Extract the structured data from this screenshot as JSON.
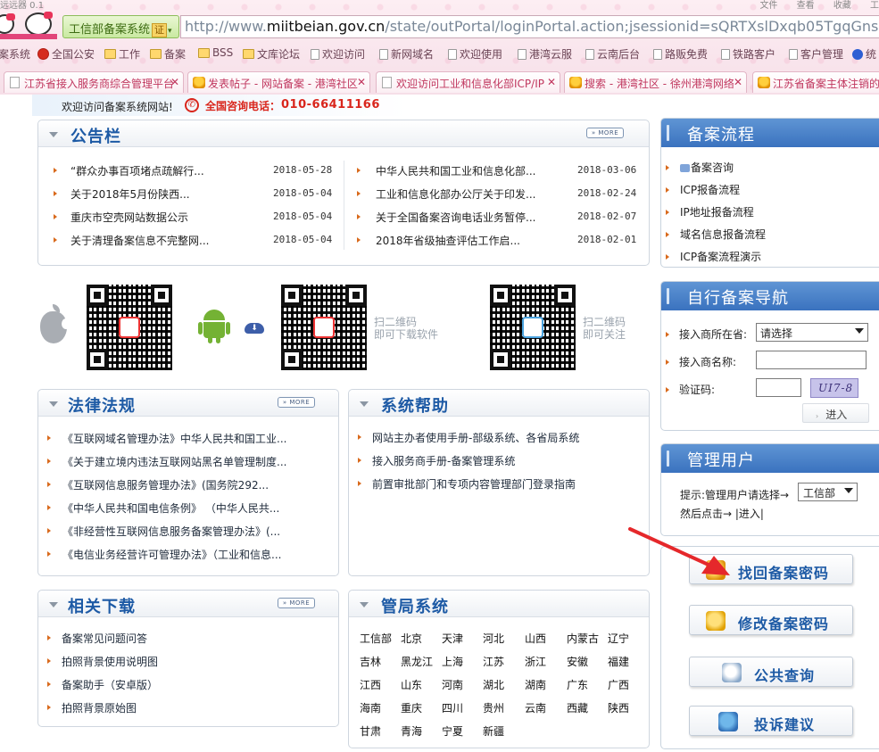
{
  "browser": {
    "top_left_text": "远远器 0.1",
    "top_right": [
      "文件",
      "查看",
      "收藏",
      "工"
    ],
    "site_badge": "工信部备案系统",
    "cert_label": "证",
    "url_prefix": "http://www.",
    "url_domain": "miitbeian.gov.cn",
    "url_rest": "/state/outPortal/loginPortal.action;jsessionid=sQRTXslDxqb05TgqGnsgrh2Fpv7",
    "bookmarks": [
      "案系统",
      "全国公安",
      "工作",
      "备案",
      "BSS",
      "文库论坛",
      "欢迎访问",
      "新网域名",
      "欢迎使用",
      "港湾云服",
      "云南后台",
      "路贩免费",
      "铁路客户",
      "客户管理",
      "统"
    ],
    "tabs": [
      "江苏省接入服务商综合管理平台",
      "发表帖子 - 网站备案 - 港湾社区",
      "欢迎访问工业和信息化部ICP/IP",
      "搜索 - 港湾社区 - 徐州港湾网络",
      "江苏省备案主体注销的"
    ]
  },
  "banner": {
    "welcome": "欢迎访问备案系统网站!",
    "hotline_label": "全国咨询电话：",
    "hotline_number": "010-66411166"
  },
  "bulletin": {
    "title": "公告栏",
    "more": "» MORE",
    "left": [
      {
        "text": "“群众办事百项堵点疏解行...",
        "date": "2018-05-28"
      },
      {
        "text": "关于2018年5月份陕西...",
        "date": "2018-05-04"
      },
      {
        "text": "重庆市空壳网站数据公示",
        "date": "2018-05-04"
      },
      {
        "text": "关于清理备案信息不完整网...",
        "date": "2018-05-04"
      }
    ],
    "right": [
      {
        "text": "中华人民共和国工业和信息化部...",
        "date": "2018-03-06"
      },
      {
        "text": "工业和信息化部办公厅关于印发...",
        "date": "2018-02-24"
      },
      {
        "text": "关于全国备案咨询电话业务暂停...",
        "date": "2018-02-07"
      },
      {
        "text": "2018年省级抽查评估工作启...",
        "date": "2018-02-01"
      }
    ]
  },
  "qr": {
    "download_hint_1": "扫二维码",
    "download_hint_2": "即可下载软件",
    "follow_hint_1": "扫二维码",
    "follow_hint_2": "即可关注"
  },
  "laws": {
    "title": "法律法规",
    "more": "» MORE",
    "items": [
      "《互联网域名管理办法》中华人民共和国工业...",
      "《关于建立境内违法互联网站黑名单管理制度...",
      "《互联网信息服务管理办法》(国务院292...",
      "《中华人民共和国电信条例》 （中华人民共...",
      "《非经营性互联网信息服务备案管理办法》(...",
      "《电信业务经营许可管理办法》（工业和信息..."
    ]
  },
  "help": {
    "title": "系统帮助",
    "items": [
      "网站主办者使用手册-部级系统、各省局系统",
      "接入服务商手册-备案管理系统",
      "前置审批部门和专项内容管理部门登录指南"
    ]
  },
  "downloads": {
    "title": "相关下载",
    "more": "» MORE",
    "items": [
      "备案常见问题问答",
      "拍照背景使用说明图",
      "备案助手（安卓版）",
      "拍照背景原始图"
    ]
  },
  "bureau": {
    "title": "管局系统",
    "rows": [
      [
        "工信部",
        "北京",
        "天津",
        "河北",
        "山西",
        "内蒙古",
        "辽宁"
      ],
      [
        "吉林",
        "黑龙江",
        "上海",
        "江苏",
        "浙江",
        "安徽",
        "福建"
      ],
      [
        "江西",
        "山东",
        "河南",
        "湖北",
        "湖南",
        "广东",
        "广西"
      ],
      [
        "海南",
        "重庆",
        "四川",
        "贵州",
        "云南",
        "西藏",
        "陕西"
      ],
      [
        "甘肃",
        "青海",
        "宁夏",
        "新疆"
      ]
    ]
  },
  "process": {
    "title": "备案流程",
    "items": [
      "备案咨询",
      "ICP报备流程",
      "IP地址报备流程",
      "域名信息报备流程",
      "ICP备案流程演示"
    ]
  },
  "self_nav": {
    "title": "自行备案导航",
    "province_label": "接入商所在省:",
    "province_value": "请选择",
    "name_label": "接入商名称:",
    "name_value": "",
    "captcha_label": "验证码:",
    "captcha_value": "",
    "captcha_text": "UI7-8",
    "enter_label": "进入"
  },
  "admin": {
    "title": "管理用户",
    "hint": "提示:管理用户请选择→",
    "select_value": "工信部",
    "then": "然后点击→",
    "enter_link": "|进入|"
  },
  "actions": {
    "retrieve_password": "找回备案密码",
    "change_password": "修改备案密码",
    "public_query": "公共查询",
    "complaint": "投诉建议"
  },
  "colors": {
    "accent": "#1d5aa5",
    "hotline": "#d9261c",
    "right_header": "#3a72bf",
    "annotation_arrow": "#e5282b"
  }
}
